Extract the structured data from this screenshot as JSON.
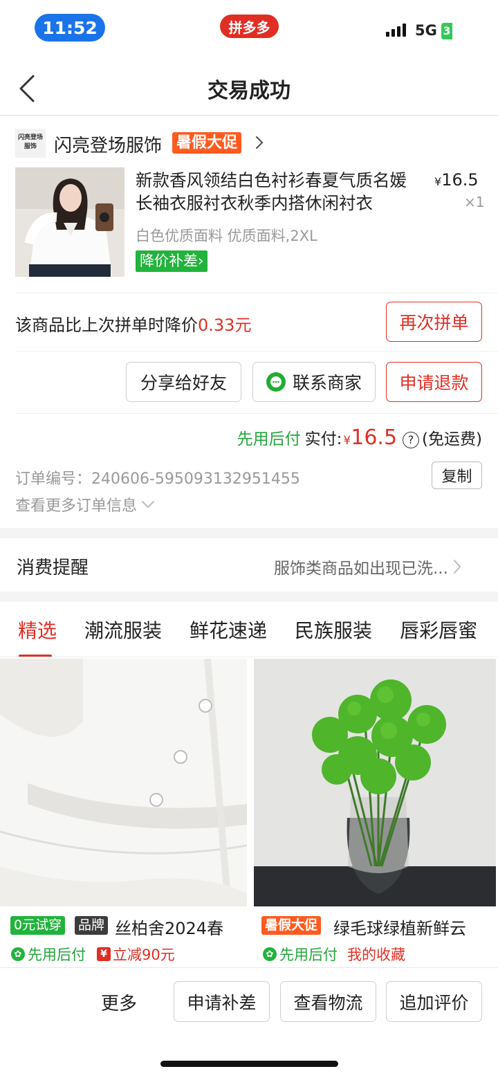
{
  "status_bar": {
    "time": "11:52",
    "app_label": "拼多多",
    "network": "5G",
    "battery": "3"
  },
  "nav": {
    "title": "交易成功"
  },
  "shop": {
    "logo_text": "闪亮登场服饰",
    "name": "闪亮登场服饰",
    "promo_tag": "暑假大促"
  },
  "product": {
    "title": "新款香风领结白色衬衫春夏气质名媛长袖衣服衬衣秋季内搭休闲衬衣",
    "currency": "¥",
    "price": "16.5",
    "qty": "×1",
    "spec": "白色优质面料 优质面料,2XL",
    "subsidy_tag": "降价补差",
    "subsidy_chevron": "›"
  },
  "price_drop": {
    "text": "该商品比上次拼单时降价",
    "amount": "0.33元",
    "reorder_label": "再次拼单"
  },
  "actions": {
    "share_label": "分享给好友",
    "contact_label": "联系商家",
    "refund_label": "申请退款"
  },
  "payment": {
    "pay_later": "先用后付",
    "paid_label": "实付:",
    "currency": "¥",
    "amount": "16.5",
    "help": "?",
    "shipping": "(免运费)"
  },
  "order": {
    "number_text": "订单编号：240606-595093132951455",
    "copy_label": "复制",
    "more_info_label": "查看更多订单信息"
  },
  "reminder": {
    "label": "消费提醒",
    "text": "服饰类商品如出现已洗..."
  },
  "tabs": [
    "精选",
    "潮流服装",
    "鲜花速递",
    "民族服装",
    "唇彩唇蜜"
  ],
  "feed": [
    {
      "tag1": "0元试穿",
      "tag2": "品牌",
      "title": "丝柏舍2024春",
      "pay_later": "先用后付",
      "discount_icon": "¥",
      "discount": "立减90元"
    },
    {
      "tag1": "暑假大促",
      "title": "绿毛球绿植新鲜云",
      "pay_later": "先用后付",
      "collect": "我的收藏"
    }
  ],
  "bottom_bar": {
    "more_label": "更多",
    "btn1": "申请补差",
    "btn2": "查看物流",
    "btn3": "追加评价"
  },
  "colors": {
    "brand_red": "#e02e24",
    "green": "#22b33c",
    "promo_orange": "#ff5a1f",
    "time_blue": "#1a73e8"
  },
  "icons": [
    "back-arrow-icon",
    "signal-icon",
    "battery-icon",
    "chevron-right-icon",
    "wechat-icon",
    "question-icon",
    "chevron-down-icon",
    "pay-later-badge-icon",
    "discount-icon"
  ]
}
